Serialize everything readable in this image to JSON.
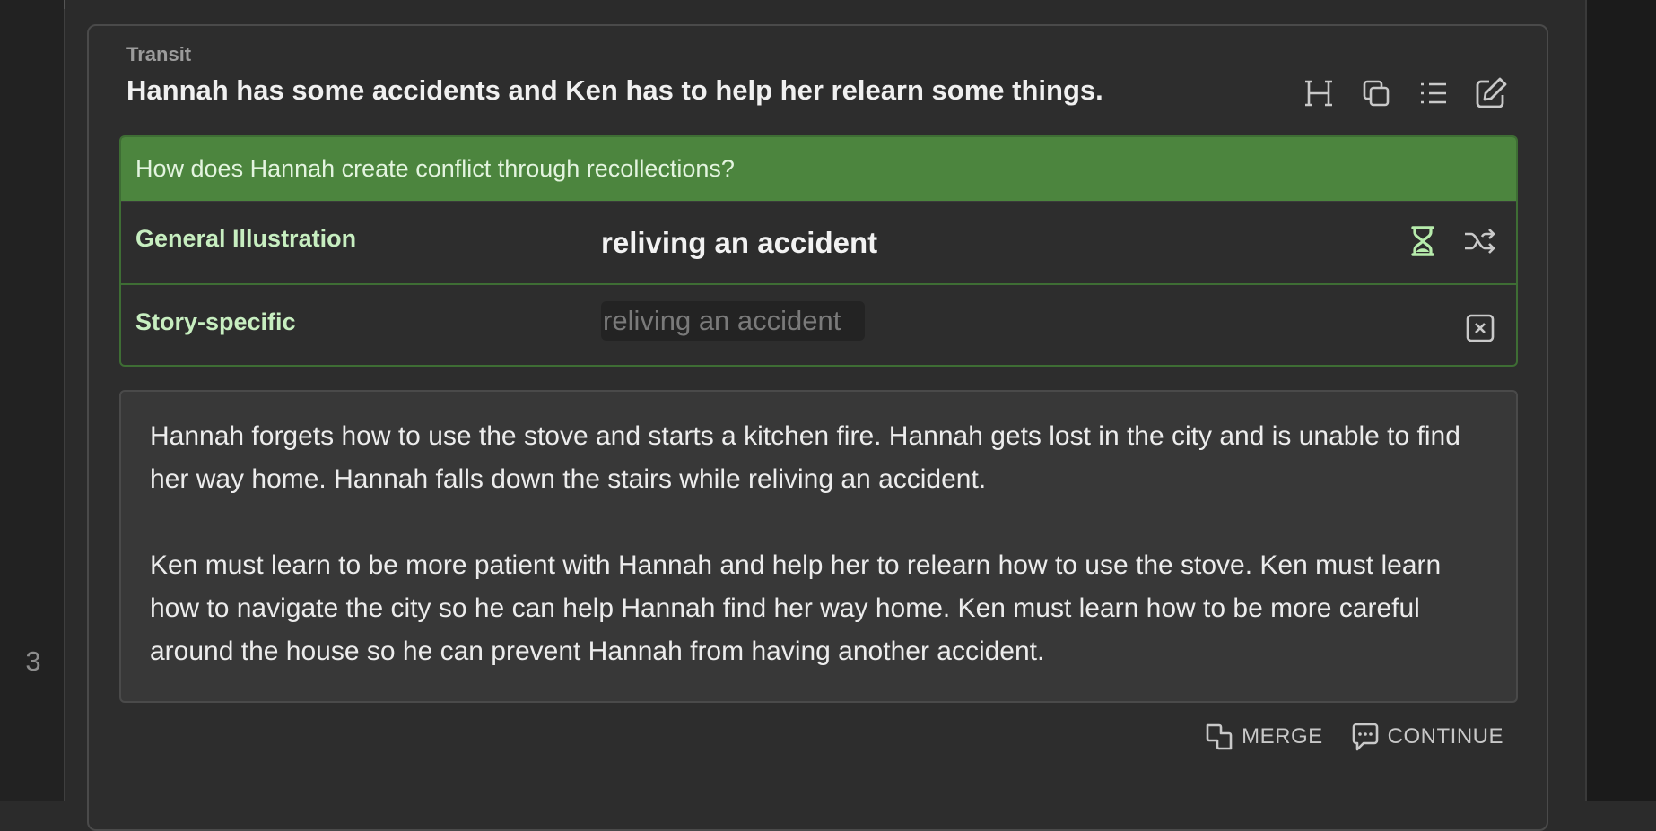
{
  "gutter": {
    "line_number": "3"
  },
  "card": {
    "label": "Transit",
    "title": "Hannah has some accidents and Ken has to help her relearn some things.",
    "toolbar_icons": [
      "heading-icon",
      "copy-icon",
      "list-icon",
      "edit-icon"
    ]
  },
  "question": {
    "prompt": "How does Hannah create conflict through recollections?",
    "accent_color": "#4c853e",
    "rows": [
      {
        "label": "General Illustration",
        "value": "reliving an accident",
        "icons": [
          "hourglass-icon",
          "shuffle-icon"
        ]
      },
      {
        "label": "Story-specific",
        "value": "reliving an accident",
        "icons": [
          "clear-icon"
        ]
      }
    ]
  },
  "body_text": {
    "paragraph_1": "Hannah forgets how to use the stove and starts a kitchen fire. Hannah gets lost in the city and is unable to find her way home. Hannah falls down the stairs while reliving an accident.",
    "paragraph_2": "Ken must learn to be more patient with Hannah and help her to relearn how to use the stove. Ken must learn how to navigate the city so he can help Hannah find her way home. Ken must learn how to be more careful around the house so he can prevent Hannah from having another accident."
  },
  "actions": {
    "merge_label": "MERGE",
    "continue_label": "CONTINUE"
  }
}
